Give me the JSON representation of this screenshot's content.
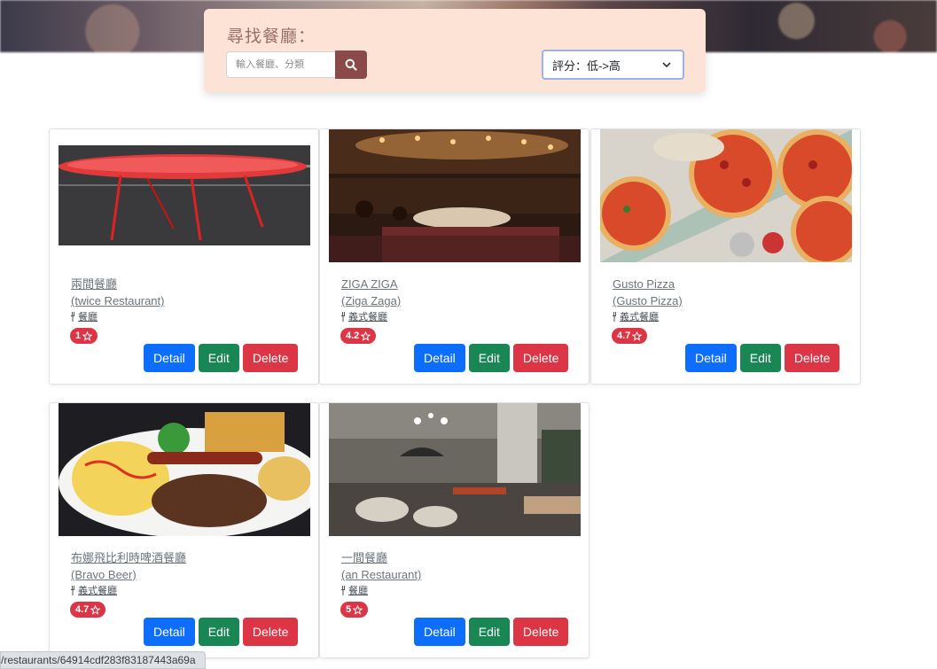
{
  "search": {
    "title": "尋找餐廳：",
    "placeholder": "輸入餐廳、分類",
    "sort_value": "評分：低->高"
  },
  "restaurants": [
    {
      "name": "兩間餐廳",
      "name_en": "(twice Restaurant)",
      "category": "餐廳",
      "rating": "1",
      "image": "red-table"
    },
    {
      "name": "ZIGA ZIGA",
      "name_en": "(Ziga Zaga)",
      "category": "義式餐廳",
      "rating": "4.2",
      "image": "restaurant-interior"
    },
    {
      "name": "Gusto Pizza",
      "name_en": "(Gusto Pizza)",
      "category": "義式餐廳",
      "rating": "4.7",
      "image": "pizzas"
    },
    {
      "name": "布娜飛比利時啤酒餐廳",
      "name_en": "(Bravo Beer)",
      "category": "義式餐廳",
      "rating": "4.7",
      "image": "omelette-platter"
    },
    {
      "name": "一間餐廳",
      "name_en": "(an Restaurant)",
      "category": "餐廳",
      "rating": "5",
      "image": "modern-dining-room"
    }
  ],
  "buttons": {
    "detail": "Detail",
    "edit": "Edit",
    "delete": "Delete"
  },
  "status_bar": {
    "url": "/restaurants/64914cdf283f83187443a69a"
  },
  "icons": {
    "search": "search-icon",
    "category": "utensils-icon",
    "rating": "star-icon",
    "dropdown": "chevron-down-icon"
  },
  "colors": {
    "panel": "#fde3d6",
    "search_button": "#8b4a4a",
    "detail": "#0d6efd",
    "edit": "#198754",
    "delete": "#dc3545"
  }
}
